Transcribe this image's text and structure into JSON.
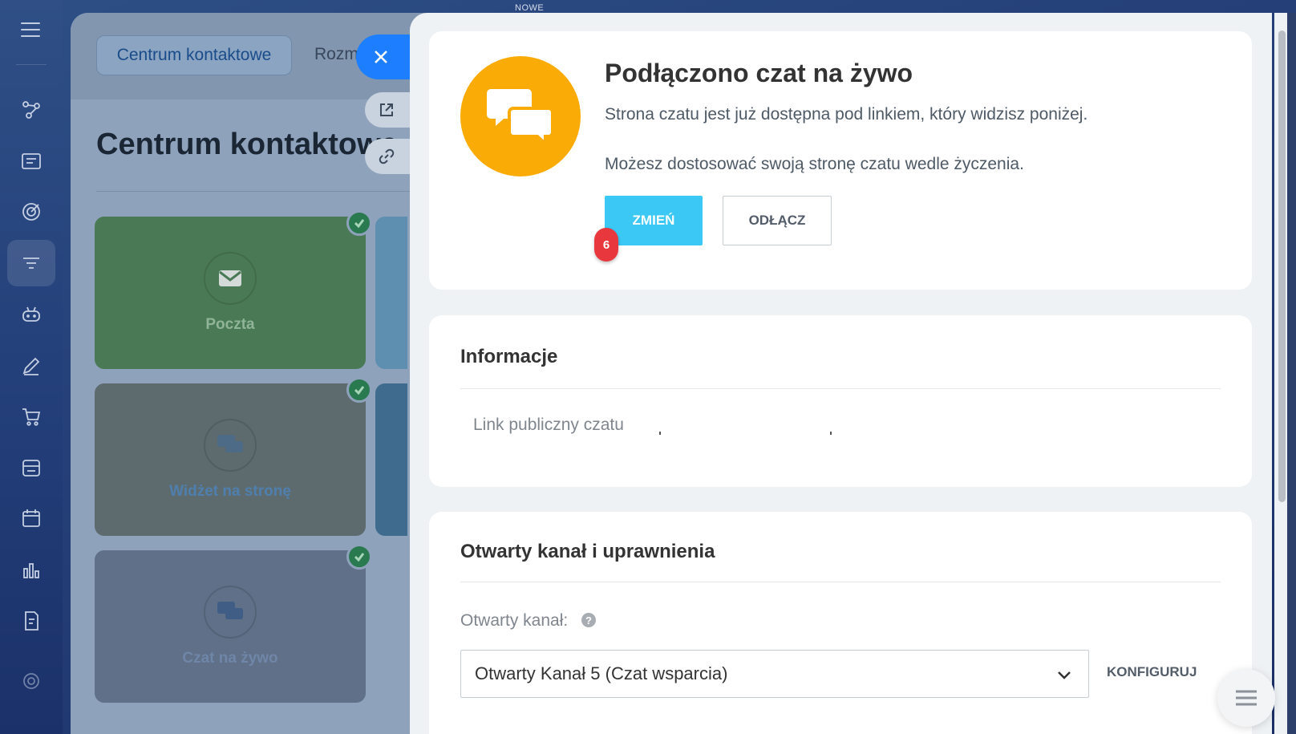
{
  "top_label": "NOWE",
  "background_page": {
    "breadcrumb_chip": "Centrum kontaktowe",
    "second_tab": "Rozm",
    "title": "Centrum kontaktowe",
    "tiles": [
      {
        "label": "Poczta",
        "icon": "mail-icon",
        "color": "#4a7a55",
        "label_color": "#8fb497"
      },
      {
        "label": "Widżet na stronę",
        "icon": "chat-bubbles-icon",
        "color": "#5d6b6e",
        "label_color": "#4f7fae"
      },
      {
        "label": "Czat na żywo",
        "icon": "chat-bubbles-icon",
        "color": "#5f7088",
        "label_color": "#6f86a8"
      }
    ]
  },
  "panel": {
    "card_connected": {
      "title": "Podłączono czat na żywo",
      "description_1": "Strona czatu jest już dostępna pod linkiem, który widzisz poniżej.",
      "description_2": "Możesz dostosować swoją stronę czatu wedle życzenia.",
      "change_label": "ZMIEŃ",
      "disconnect_label": "ODŁĄCZ",
      "step_badge": "6",
      "icon": "chat-bubbles-icon",
      "icon_color": "#fbab06"
    },
    "card_info": {
      "title": "Informacje",
      "public_link_label": "Link publiczny czatu"
    },
    "card_channel": {
      "title": "Otwarty kanał i uprawnienia",
      "open_channel_label": "Otwarty kanał:",
      "help_symbol": "?",
      "selected_channel": "Otwarty Kanał 5 (Czat wsparcia)",
      "configure_label": "KONFIGURUJ"
    }
  },
  "colors": {
    "accent_blue": "#1d7fff",
    "change_button": "#3bc8f5",
    "badge_red": "#e8383d"
  }
}
